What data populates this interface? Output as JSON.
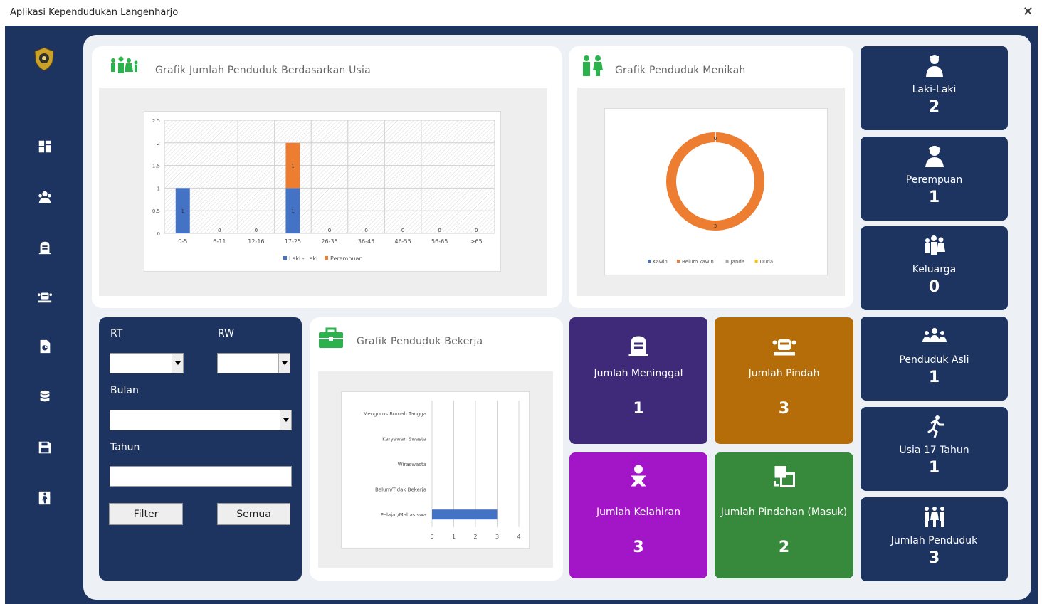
{
  "window": {
    "title": "Aplikasi Kependudukan Langenharjo",
    "close_glyph": "✕"
  },
  "sidebar": {
    "items": [
      {
        "name": "dashboard-icon"
      },
      {
        "name": "people-icon"
      },
      {
        "name": "grave-icon"
      },
      {
        "name": "move-icon"
      },
      {
        "name": "document-icon"
      },
      {
        "name": "database-icon"
      },
      {
        "name": "save-icon"
      },
      {
        "name": "exit-icon"
      }
    ]
  },
  "age_chart": {
    "title": "Grafik Jumlah Penduduk Berdasarkan Usia",
    "chart_data": {
      "type": "bar",
      "stacked": true,
      "categories": [
        "0-5",
        "6-11",
        "12-16",
        "17-25",
        "26-35",
        "36-45",
        "46-55",
        "56-65",
        ">65"
      ],
      "series": [
        {
          "name": "Laki - Laki",
          "values": [
            1,
            0,
            0,
            1,
            0,
            0,
            0,
            0,
            0
          ],
          "color": "#4472c4"
        },
        {
          "name": "Perempuan",
          "values": [
            0,
            0,
            0,
            1,
            0,
            0,
            0,
            0,
            0
          ],
          "color": "#ed7d31"
        }
      ],
      "yticks": [
        "0",
        "0.5",
        "1",
        "1.5",
        "2",
        "2.5"
      ],
      "ylim": [
        0,
        2.5
      ],
      "grid": true,
      "legend": "bottom"
    }
  },
  "married_chart": {
    "title": "Grafik Penduduk Menikah",
    "chart_data": {
      "type": "pie",
      "donut": true,
      "labels": [
        "Kawin",
        "Belum kawin",
        "Janda",
        "Duda"
      ],
      "values": [
        0,
        3,
        0,
        0
      ],
      "colors": [
        "#4472c4",
        "#ed7d31",
        "#a5a5a5",
        "#ffc000"
      ],
      "legend": "bottom"
    }
  },
  "work_chart": {
    "title": "Grafik Penduduk Bekerja",
    "chart_data": {
      "type": "bar",
      "orientation": "horizontal",
      "categories": [
        "Mengurus Rumah Tangga",
        "Karyawan Swasta",
        "Wiraswasta",
        "Belum/Tidak Bekerja",
        "Pelajar/Mahasiswa"
      ],
      "values": [
        0,
        0,
        0,
        0,
        3
      ],
      "xticks": [
        "0",
        "1",
        "2",
        "3",
        "4"
      ],
      "xlim": [
        0,
        4
      ],
      "color": "#4472c4"
    }
  },
  "filter": {
    "rt_label": "RT",
    "rw_label": "RW",
    "bulan_label": "Bulan",
    "tahun_label": "Tahun",
    "filter_button": "Filter",
    "semua_button": "Semua"
  },
  "tiles": {
    "meninggal": {
      "label": "Jumlah Meninggal",
      "value": "1",
      "color": "#3f2a7a"
    },
    "pindah": {
      "label": "Jumlah Pindah",
      "value": "3",
      "color": "#b56d0a"
    },
    "kelahiran": {
      "label": "Jumlah Kelahiran",
      "value": "3",
      "color": "#a316c8"
    },
    "pindahan": {
      "label": "Jumlah Pindahan (Masuk)",
      "value": "2",
      "color": "#378a3b"
    }
  },
  "stats": [
    {
      "label": "Laki-Laki",
      "value": "2",
      "icon": "male-icon"
    },
    {
      "label": "Perempuan",
      "value": "1",
      "icon": "female-icon"
    },
    {
      "label": "Keluarga",
      "value": "0",
      "icon": "family-icon"
    },
    {
      "label": "Penduduk Asli",
      "value": "1",
      "icon": "group-icon"
    },
    {
      "label": "Usia 17 Tahun",
      "value": "1",
      "icon": "runner-icon"
    },
    {
      "label": "Jumlah Penduduk",
      "value": "3",
      "icon": "population-icon"
    }
  ]
}
